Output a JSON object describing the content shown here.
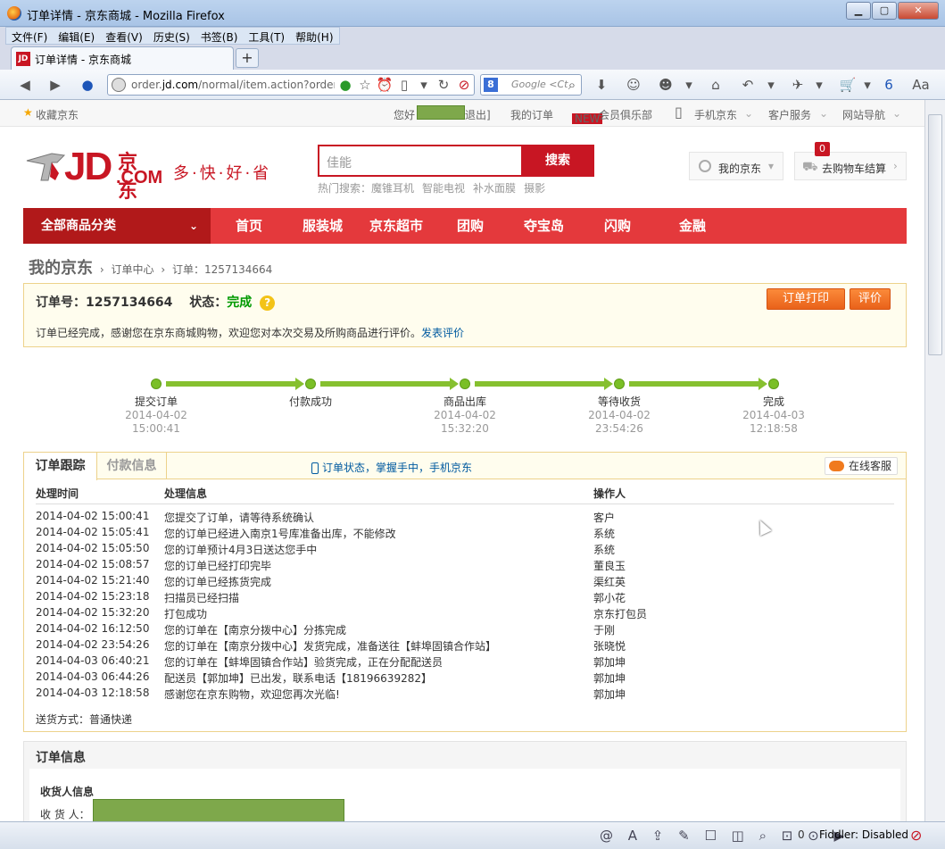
{
  "window": {
    "title": "订单详情 - 京东商城 - Mozilla Firefox",
    "menu": [
      "文件(F)",
      "编辑(E)",
      "查看(V)",
      "历史(S)",
      "书签(B)",
      "工具(T)",
      "帮助(H)"
    ],
    "tab_title": "订单详情 - 京东商城",
    "tab_favicon": "JD",
    "url_prefix": "order.",
    "url_domain": "jd.com",
    "url_rest": "/normal/item.action?orderid=",
    "search_placeholder": "Google <Ct",
    "search_engine_icon": "8"
  },
  "statusbar": {
    "count": "0",
    "fiddler": "Fiddler: Disabled"
  },
  "site_top": {
    "favorite": "收藏京东",
    "hello": "您好",
    "logout": "退出]",
    "my_order": "我的订单",
    "new_badge": "NEW",
    "vip": "会员俱乐部",
    "mobile": "手机京东",
    "service": "客户服务",
    "site_nav": "网站导航"
  },
  "header": {
    "logo_jd": "JD",
    "logo_cn": "京东",
    "logo_com": ".COM",
    "slogan": "多·快·好·省",
    "search_value": "佳能",
    "search_button": "搜索",
    "hot_label": "热门搜索：",
    "hot_items": [
      "魔锥耳机",
      "智能电视",
      "补水面膜",
      "摄影"
    ],
    "my_jd": "我的京东",
    "cart": "去购物车结算",
    "cart_count": "0"
  },
  "nav": {
    "all": "全部商品分类",
    "items": [
      "首页",
      "服装城",
      "京东超市",
      "团购",
      "夺宝岛",
      "闪购",
      "金融"
    ]
  },
  "breadcrumb": {
    "root": "我的京东",
    "center": "订单中心",
    "order": "订单：1257134664"
  },
  "order": {
    "number_label": "订单号：",
    "number": "1257134664",
    "status_label": "状态：",
    "status": "完成",
    "print_button": "订单打印",
    "review_button": "评价",
    "message": "订单已经完成，感谢您在京东商城购物，欢迎您对本次交易及所购商品进行评价。",
    "review_link": "发表评价"
  },
  "progress": [
    {
      "name": "提交订单",
      "date": "2014-04-02",
      "time": "15:00:41"
    },
    {
      "name": "付款成功",
      "date": "",
      "time": ""
    },
    {
      "name": "商品出库",
      "date": "2014-04-02",
      "time": "15:32:20"
    },
    {
      "name": "等待收货",
      "date": "2014-04-02",
      "time": "23:54:26"
    },
    {
      "name": "完成",
      "date": "2014-04-03",
      "time": "12:18:58"
    }
  ],
  "tracking": {
    "tab_active": "订单跟踪",
    "tab_other": "付款信息",
    "mobile_tip": "订单状态，掌握手中，手机京东",
    "online_service": "在线客服",
    "headers": [
      "处理时间",
      "处理信息",
      "操作人"
    ],
    "rows": [
      [
        "2014-04-02 15:00:41",
        "您提交了订单，请等待系统确认",
        "客户"
      ],
      [
        "2014-04-02 15:05:41",
        "您的订单已经进入南京1号库准备出库，不能修改",
        "系统"
      ],
      [
        "2014-04-02 15:05:50",
        "您的订单预计4月3日送达您手中",
        "系统"
      ],
      [
        "2014-04-02 15:08:57",
        "您的订单已经打印完毕",
        "董良玉"
      ],
      [
        "2014-04-02 15:21:40",
        "您的订单已经拣货完成",
        "渠红英"
      ],
      [
        "2014-04-02 15:23:18",
        "扫描员已经扫描",
        "郭小花"
      ],
      [
        "2014-04-02 15:32:20",
        "打包成功",
        "京东打包员"
      ],
      [
        "2014-04-02 16:12:50",
        "您的订单在【南京分拨中心】分拣完成",
        "于刚"
      ],
      [
        "2014-04-02 23:54:26",
        "您的订单在【南京分拨中心】发货完成，准备送往【蚌埠固镇合作站】",
        "张晓悦"
      ],
      [
        "2014-04-03 06:40:21",
        "您的订单在【蚌埠固镇合作站】验货完成，正在分配配送员",
        "郭加坤"
      ],
      [
        "2014-04-03 06:44:26",
        "配送员【郭加坤】已出发，联系电话【18196639282】",
        "郭加坤"
      ],
      [
        "2014-04-03 12:18:58",
        "感谢您在京东购物，欢迎您再次光临!",
        "郭加坤"
      ]
    ],
    "shipping": "送货方式：普通快递"
  },
  "order_info": {
    "title": "订单信息",
    "receiver_title": "收货人信息",
    "receiver_label": "收 货 人："
  },
  "colors": {
    "brand_red": "#c81623",
    "nav_red": "#e4393c",
    "status_green": "#009900",
    "link_blue": "#005aa0",
    "progress_green": "#86c02f",
    "button_orange": "#f07a1e"
  }
}
